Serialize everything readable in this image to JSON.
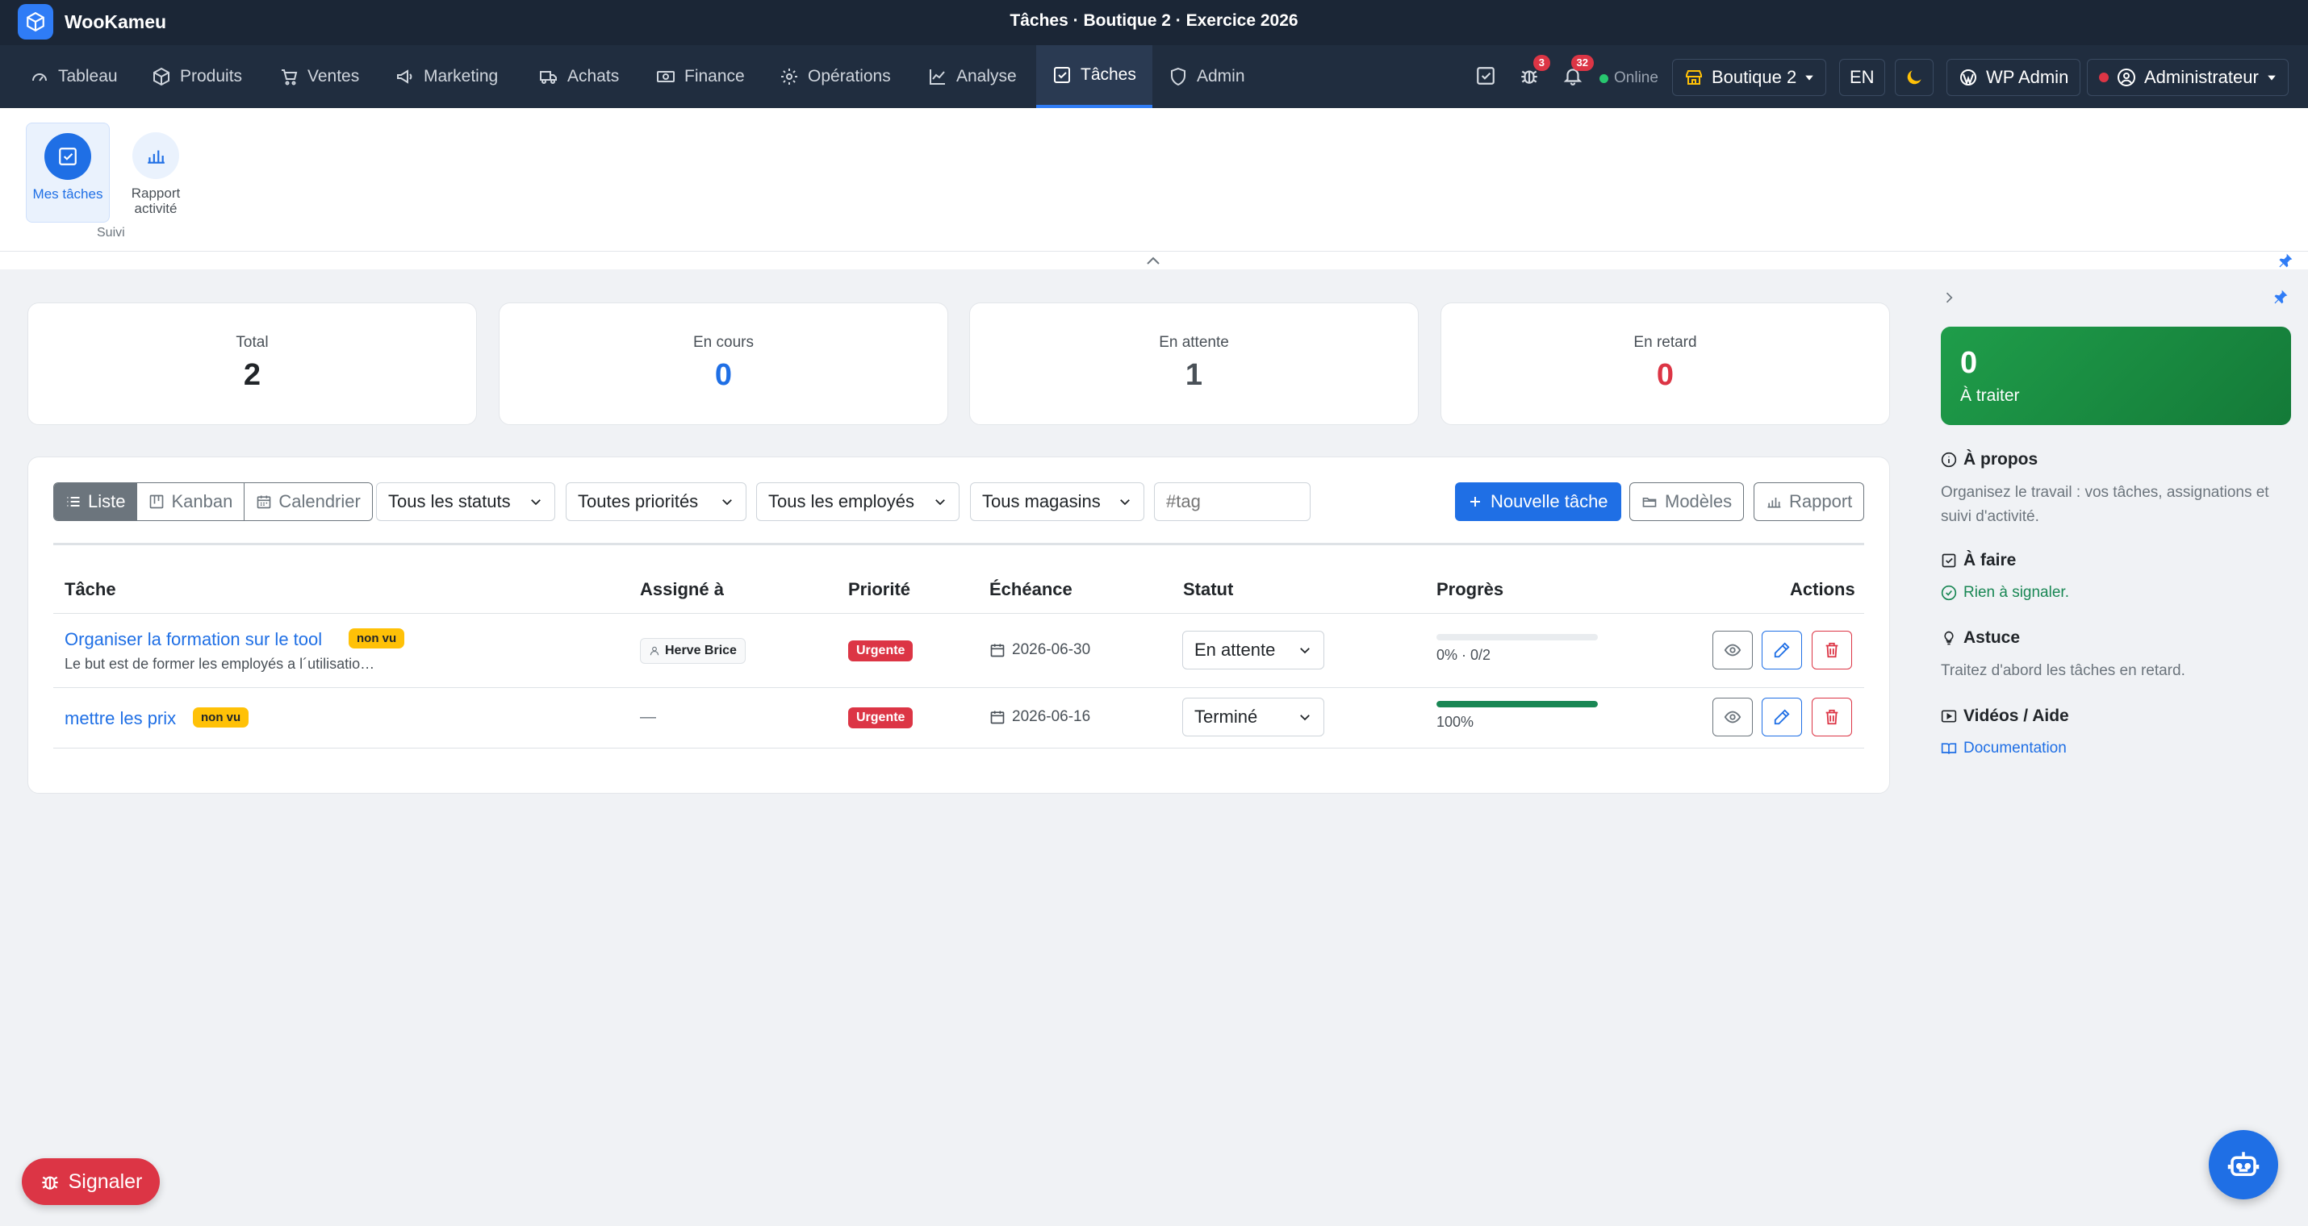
{
  "app": {
    "name": "WooKameu",
    "window_title": "Tâches  ·  Boutique 2 · Exercice 2026"
  },
  "nav": {
    "items": [
      {
        "label": "Tableau",
        "icon": "dashboard-icon"
      },
      {
        "label": "Produits",
        "icon": "box-icon"
      },
      {
        "label": "Ventes",
        "icon": "cart-icon"
      },
      {
        "label": "Marketing",
        "icon": "megaphone-icon"
      },
      {
        "label": "Achats",
        "icon": "truck-icon"
      },
      {
        "label": "Finance",
        "icon": "cash-icon"
      },
      {
        "label": "Opérations",
        "icon": "gear-icon"
      },
      {
        "label": "Analyse",
        "icon": "chart-line-icon"
      },
      {
        "label": "Tâches",
        "icon": "check-square-icon",
        "active": true
      },
      {
        "label": "Admin",
        "icon": "shield-icon"
      }
    ],
    "bug_badge": "3",
    "notif_badge": "32",
    "online": "Online",
    "store": "Boutique 2",
    "lang": "EN",
    "wp_admin": "WP Admin",
    "user": "Administrateur"
  },
  "ribbon": {
    "items": [
      {
        "label": "Mes tâches",
        "active": true
      },
      {
        "label": "Rapport activité"
      }
    ],
    "group_label": "Suivi"
  },
  "stats": [
    {
      "label": "Total",
      "value": "2",
      "color": "#212529"
    },
    {
      "label": "En cours",
      "value": "0",
      "color": "#1f6fe5"
    },
    {
      "label": "En attente",
      "value": "1",
      "color": "#495057"
    },
    {
      "label": "En retard",
      "value": "0",
      "color": "#dc3545"
    }
  ],
  "toolbar": {
    "views": [
      "Liste",
      "Kanban",
      "Calendrier"
    ],
    "filters": {
      "status": "Tous les statuts",
      "priority": "Toutes priorités",
      "employee": "Tous les employés",
      "store": "Tous magasins"
    },
    "tag_placeholder": "#tag",
    "new_task": "Nouvelle tâche",
    "templates": "Modèles",
    "report": "Rapport"
  },
  "table": {
    "headers": {
      "task": "Tâche",
      "assigned": "Assigné à",
      "priority": "Priorité",
      "due": "Échéance",
      "status": "Statut",
      "progress": "Progrès",
      "actions": "Actions"
    },
    "rows": [
      {
        "title": "Organiser la formation sur le tool",
        "badge": "non vu",
        "description": "Le but est de former les employés a l´utilisatio…",
        "assignee": "Herve Brice",
        "priority": "Urgente",
        "due": "2026-06-30",
        "status": "En attente",
        "progress": 0,
        "progress_label": "0% · 0/2"
      },
      {
        "title": "mettre les prix",
        "badge": "non vu",
        "description": "",
        "assignee": "—",
        "priority": "Urgente",
        "due": "2026-06-16",
        "status": "Terminé",
        "progress": 100,
        "progress_label": "100%"
      }
    ]
  },
  "sidebar": {
    "todo_count": "0",
    "todo_label": "À traiter",
    "about_title": "À propos",
    "about_text": "Organisez le travail : vos tâches, assignations et suivi d'activité.",
    "todo_title": "À faire",
    "todo_status": "Rien à signaler.",
    "tip_title": "Astuce",
    "tip_text": "Traitez d'abord les tâches en retard.",
    "videos_title": "Vidéos / Aide",
    "doc_link": "Documentation"
  },
  "footer": {
    "report_button": "Signaler"
  },
  "colors": {
    "primary": "#1f6fe5",
    "danger": "#dc3545",
    "success": "#198754",
    "warning": "#ffc107",
    "navbar": "#202d3f"
  }
}
